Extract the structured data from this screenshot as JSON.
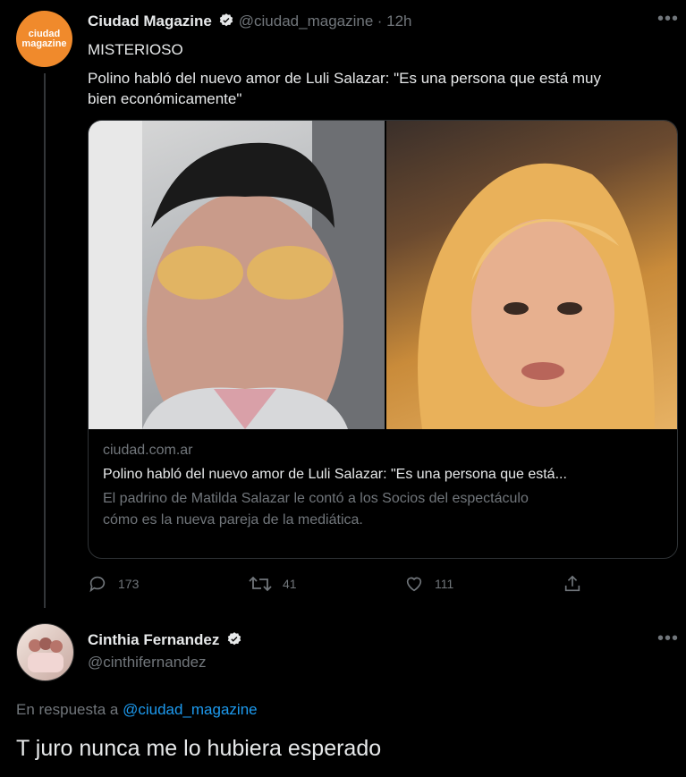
{
  "tweet1": {
    "avatar_text": [
      "ciudad",
      "magazine"
    ],
    "name": "Ciudad Magazine",
    "handle": "@ciudad_magazine",
    "time": "· 12h",
    "line1": "MISTERIOSO",
    "line2": "Polino habló del nuevo amor de Luli Salazar: \"Es una persona que está muy",
    "line3": "bien económicamente\"",
    "card": {
      "domain": "ciudad.com.ar",
      "title": "Polino habló del nuevo amor de Luli Salazar: \"Es una persona que está...",
      "desc1": "El padrino de Matilda Salazar le contó a los Socios del espectáculo",
      "desc2": "cómo es la nueva pareja de la mediática."
    },
    "actions": {
      "replies": "173",
      "retweets": "41",
      "likes": "111"
    }
  },
  "tweet2": {
    "name": "Cinthia Fernandez",
    "handle": "@cinthifernandez",
    "reply_prefix": "En respuesta a",
    "reply_to": "@ciudad_magazine",
    "text": "T juro nunca me lo hubiera esperado"
  },
  "colors": {
    "accent": "#1d9bf0",
    "brand": "#f08a2c",
    "muted": "#71767b"
  }
}
